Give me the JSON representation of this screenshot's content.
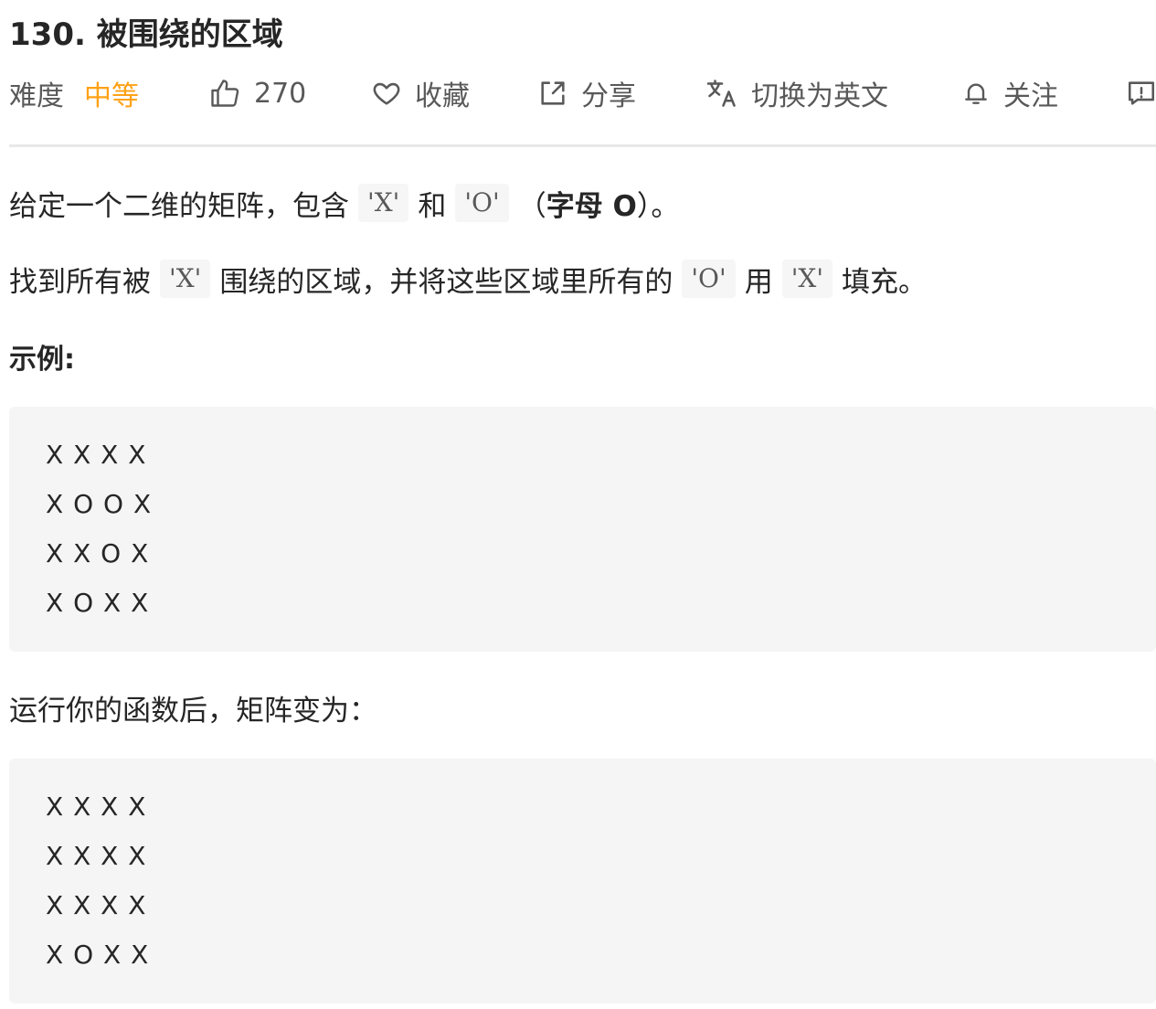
{
  "title": "130. 被围绕的区域",
  "toolbar": {
    "difficulty_label": "难度",
    "difficulty_value": "中等",
    "likes": "270",
    "favorite_label": "收藏",
    "share_label": "分享",
    "translate_label": "切换为英文",
    "follow_label": "关注",
    "accent_color": "#ffa116"
  },
  "description": {
    "p1_prefix": "给定一个二维的矩阵，包含",
    "p1_code1": "'X'",
    "p1_mid": "和",
    "p1_code2": "'O'",
    "p1_paren_open": "（",
    "p1_bold": "字母 O",
    "p1_paren_close": "）。",
    "p2_prefix": "找到所有被",
    "p2_code1": "'X'",
    "p2_mid1": "围绕的区域，并将这些区域里所有的",
    "p2_code2": "'O'",
    "p2_mid2": "用",
    "p2_code3": "'X'",
    "p2_suffix": "填充。",
    "example_heading": "示例:",
    "after_text": "运行你的函数后，矩阵变为："
  },
  "example_before": [
    "X X X X",
    "X O O X",
    "X X O X",
    "X O X X"
  ],
  "example_after": [
    "X X X X",
    "X X X X",
    "X X X X",
    "X O X X"
  ]
}
